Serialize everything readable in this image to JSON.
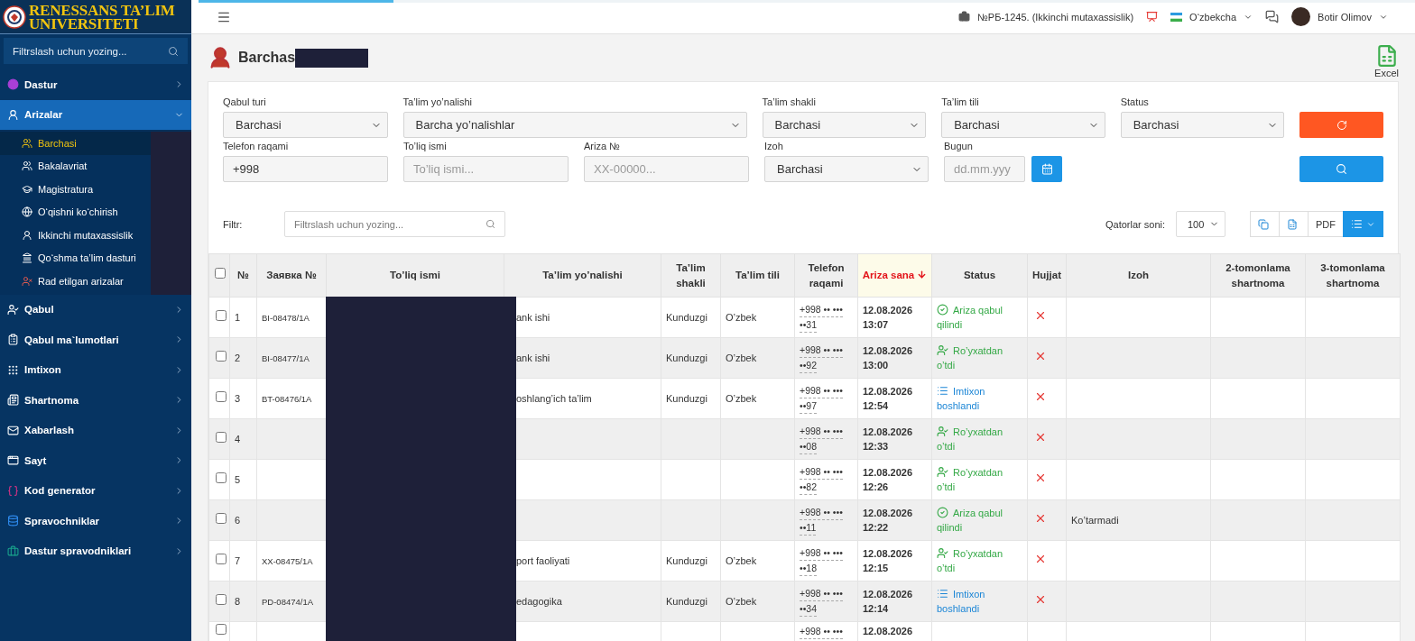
{
  "logo": {
    "line_1": "RENESSANS TA’LIM",
    "line_2": "UNIVERSITETI"
  },
  "sidebar": {
    "search_placeholder": "Filtrslash uchun yozing...",
    "items": [
      {
        "label": "Dastur",
        "selected": false,
        "expanded": false
      },
      {
        "label": "Arizalar",
        "selected": true,
        "expanded": true,
        "children": [
          {
            "label": "Barchasi",
            "selected": true
          },
          {
            "label": "Bakalavriat",
            "selected": false
          },
          {
            "label": "Magistratura",
            "selected": false
          },
          {
            "label": "O‘qishni ko‘chirish",
            "selected": false
          },
          {
            "label": "Ikkinchi mutaxassislik",
            "selected": false
          },
          {
            "label": "Qo‘shma ta’lim dasturi",
            "selected": false
          },
          {
            "label": "Rad etilgan arizalar",
            "selected": false
          }
        ]
      },
      {
        "label": "Qabul",
        "selected": false,
        "expanded": false
      },
      {
        "label": "Qabul ma`lumotlari",
        "selected": false,
        "expanded": false
      },
      {
        "label": "Imtixon",
        "selected": false,
        "expanded": false
      },
      {
        "label": "Shartnoma",
        "selected": false,
        "expanded": false
      },
      {
        "label": "Xabarlash",
        "selected": false,
        "expanded": false
      },
      {
        "label": "Sayt",
        "selected": false,
        "expanded": false
      },
      {
        "label": "Kod generator",
        "selected": false,
        "expanded": false
      },
      {
        "label": "Spravochniklar",
        "selected": false,
        "expanded": false
      },
      {
        "label": "Dastur spravodniklari",
        "selected": false,
        "expanded": false
      }
    ]
  },
  "topbar": {
    "progress": {
      "level": 0.16
    },
    "context": "№РБ-1245. (Ikkinchi mutaxassislik)",
    "language": "O‘zbekcha",
    "user": "Botir Olimov"
  },
  "page": {
    "title": "Barchas",
    "export_label": "Excel"
  },
  "filters": {
    "row_1": [
      {
        "kind": "select",
        "label": "Qabul turi",
        "value": "Barchasi"
      },
      {
        "kind": "select",
        "label": "Ta’lim yo’nalishi",
        "value": "Barcha yo’nalishlar"
      },
      {
        "kind": "select",
        "label": "Ta’lim shakli",
        "value": "Barchasi"
      },
      {
        "kind": "select",
        "label": "Ta’lim tili",
        "value": "Barchasi"
      },
      {
        "kind": "select",
        "label": "Status",
        "value": "Barchasi"
      }
    ],
    "row_2": [
      {
        "kind": "input",
        "label": "Telefon raqami",
        "value": "+998"
      },
      {
        "kind": "input",
        "label": "To’liq ismi",
        "placeholder": "To’liq ismi..."
      },
      {
        "kind": "input",
        "label": "Ariza №",
        "placeholder": "XX-00000..."
      },
      {
        "kind": "select",
        "label": "Izoh",
        "value": "Barchasi"
      },
      {
        "kind": "date",
        "label": "Bugun",
        "placeholder": "dd.mm.yyy"
      }
    ]
  },
  "toolbar": {
    "filter_label": "Filtr:",
    "filter_placeholder": "Filtrslash uchun yozing...",
    "rows_label": "Qatorlar soni:",
    "rows_value": "100",
    "pdf_label": "PDF"
  },
  "table": {
    "select_all": {
      "checked": false
    },
    "columns": [
      {
        "label": "№",
        "sorted": false
      },
      {
        "label": "Заявка №",
        "sorted": false
      },
      {
        "label": "To’liq ismi",
        "sorted": false
      },
      {
        "label": "Ta’lim yo’nalishi",
        "sorted": false
      },
      {
        "label": "Ta’lim shakli",
        "sorted": false
      },
      {
        "label": "Ta’lim tili",
        "sorted": false
      },
      {
        "label": "Telefon raqami",
        "sorted": false
      },
      {
        "label": "Ariza sana",
        "sorted": true
      },
      {
        "label": "Status",
        "sorted": false
      },
      {
        "label": "Hujjat",
        "sorted": false
      },
      {
        "label": "Izoh",
        "sorted": false
      },
      {
        "label": "2-tomonlama shartnoma",
        "sorted": false
      },
      {
        "label": "3-tomonlama shartnoma",
        "sorted": false
      }
    ],
    "rows": [
      {
        "checked": false,
        "number": "1",
        "code": "BI-08478/1A",
        "direction": "ank ishi",
        "form": "Kunduzgi",
        "language": "O’zbek",
        "phone_line_1": "+998 •• •••",
        "phone_line_2": "••31",
        "date": "12.08.2026",
        "time": "13:07",
        "status": {
          "kind": "accepted",
          "label": "Ariza qabul qilindi"
        }
      },
      {
        "checked": false,
        "number": "2",
        "code": "BI-08477/1A",
        "direction": "ank ishi",
        "form": "Kunduzgi",
        "language": "O’zbek",
        "phone_line_1": "+998 •• •••",
        "phone_line_2": "••92",
        "date": "12.08.2026",
        "time": "13:00",
        "status": {
          "kind": "registered",
          "label": "Ro’yxatdan o’tdi"
        }
      },
      {
        "checked": false,
        "number": "3",
        "code": "BT-08476/1A",
        "direction": "oshlang’ich ta’lim",
        "form": "Kunduzgi",
        "language": "O’zbek",
        "phone_line_1": "+998 •• •••",
        "phone_line_2": "••97",
        "date": "12.08.2026",
        "time": "12:54",
        "status": {
          "kind": "exam",
          "label": "Imtixon boshlandi"
        }
      },
      {
        "checked": false,
        "number": "4",
        "phone_line_1": "+998 •• •••",
        "phone_line_2": "••08",
        "date": "12.08.2026",
        "time": "12:33",
        "status": {
          "kind": "registered",
          "label": "Ro’yxatdan o’tdi"
        }
      },
      {
        "checked": false,
        "number": "5",
        "phone_line_1": "+998 •• •••",
        "phone_line_2": "••82",
        "date": "12.08.2026",
        "time": "12:26",
        "status": {
          "kind": "registered",
          "label": "Ro’yxatdan o’tdi"
        }
      },
      {
        "checked": false,
        "number": "6",
        "phone_line_1": "+998 •• •••",
        "phone_line_2": "••11",
        "date": "12.08.2026",
        "time": "12:22",
        "status": {
          "kind": "accepted",
          "label": "Ariza qabul qilindi"
        },
        "note": "Ko’tarmadi"
      },
      {
        "checked": false,
        "number": "7",
        "code": "XX-08475/1A",
        "direction": "port faoliyati",
        "form": "Kunduzgi",
        "language": "O’zbek",
        "phone_line_1": "+998 •• •••",
        "phone_line_2": "••18",
        "date": "12.08.2026",
        "time": "12:15",
        "status": {
          "kind": "registered",
          "label": "Ro’yxatdan o’tdi"
        }
      },
      {
        "checked": false,
        "number": "8",
        "code": "PD-08474/1A",
        "direction": "edagogika",
        "form": "Kunduzgi",
        "language": "O’zbek",
        "phone_line_1": "+998 •• •••",
        "phone_line_2": "••34",
        "date": "12.08.2026",
        "time": "12:14",
        "status": {
          "kind": "exam",
          "label": "Imtixon boshlandi"
        }
      },
      {
        "checked": false,
        "phone_line_1": "+998 •• •••",
        "date": "12.08.2026"
      }
    ]
  }
}
